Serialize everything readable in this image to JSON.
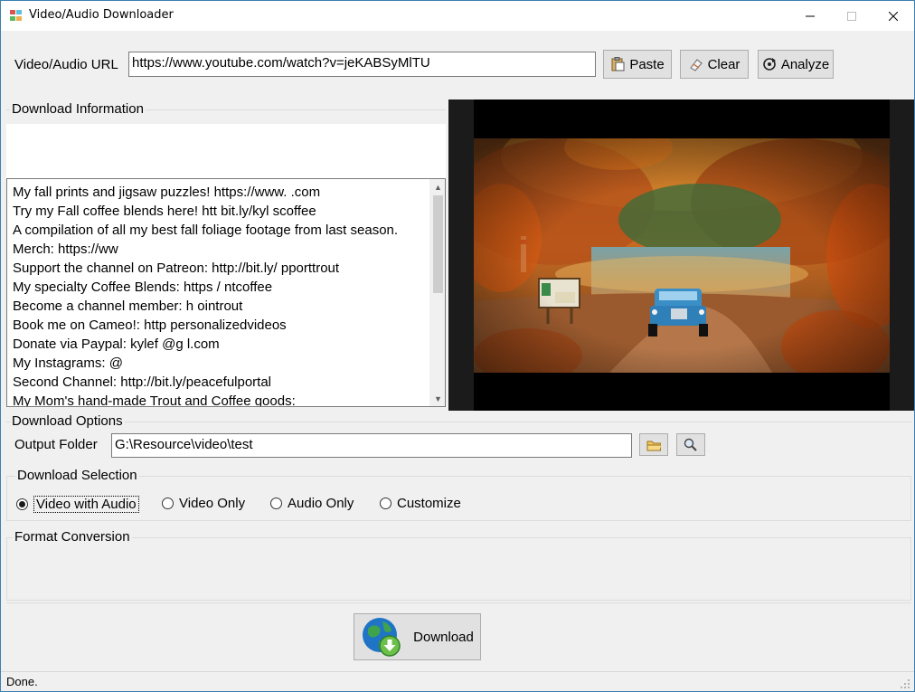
{
  "window": {
    "title": "Video/Audio Downloader",
    "minimize": "—",
    "maximize": "☐",
    "close": "✕"
  },
  "url_row": {
    "label": "Video/Audio URL",
    "url_value": "https://www.youtube.com/watch?v=jeKABSyMlTU",
    "paste_label": "Paste",
    "clear_label": "Clear",
    "analyze_label": "Analyze"
  },
  "download_info": {
    "title": "Download Information",
    "description_lines": [
      "My fall prints and jigsaw puzzles! https://www.               .com",
      "Try my Fall coffee blends here!  htt        bit.ly/kyl       scoffee",
      "A compilation of all my best fall foliage footage from last season.",
      "Merch: https://ww",
      "Support the channel on Patreon: http://bit.ly/        pporttrout",
      "My specialty Coffee Blends: https           /       ntcoffee",
      "Become a channel member: h              ointrout",
      "Book me on Cameo!: http              personalizedvideos",
      "Donate via Paypal: kylef              @g      l.com",
      "My Instagrams: @",
      "Second Channel: http://bit.ly/peacefulportal",
      "My Mom's hand-made Trout and Coffee goods:"
    ]
  },
  "download_options": {
    "title": "Download Options",
    "output_folder_label": "Output Folder",
    "output_folder_value": "G:\\Resource\\video\\test"
  },
  "download_selection": {
    "title": "Download Selection",
    "options": [
      "Video with Audio",
      "Video Only",
      "Audio Only",
      "Customize"
    ],
    "selected": "Video with Audio"
  },
  "format_conversion": {
    "title": "Format Conversion"
  },
  "download_button_label": "Download",
  "status": "Done.",
  "colors": {
    "window_border": "#3c7fb1",
    "panel_bg": "#f0f0f0",
    "button_bg": "#e1e1e1"
  }
}
